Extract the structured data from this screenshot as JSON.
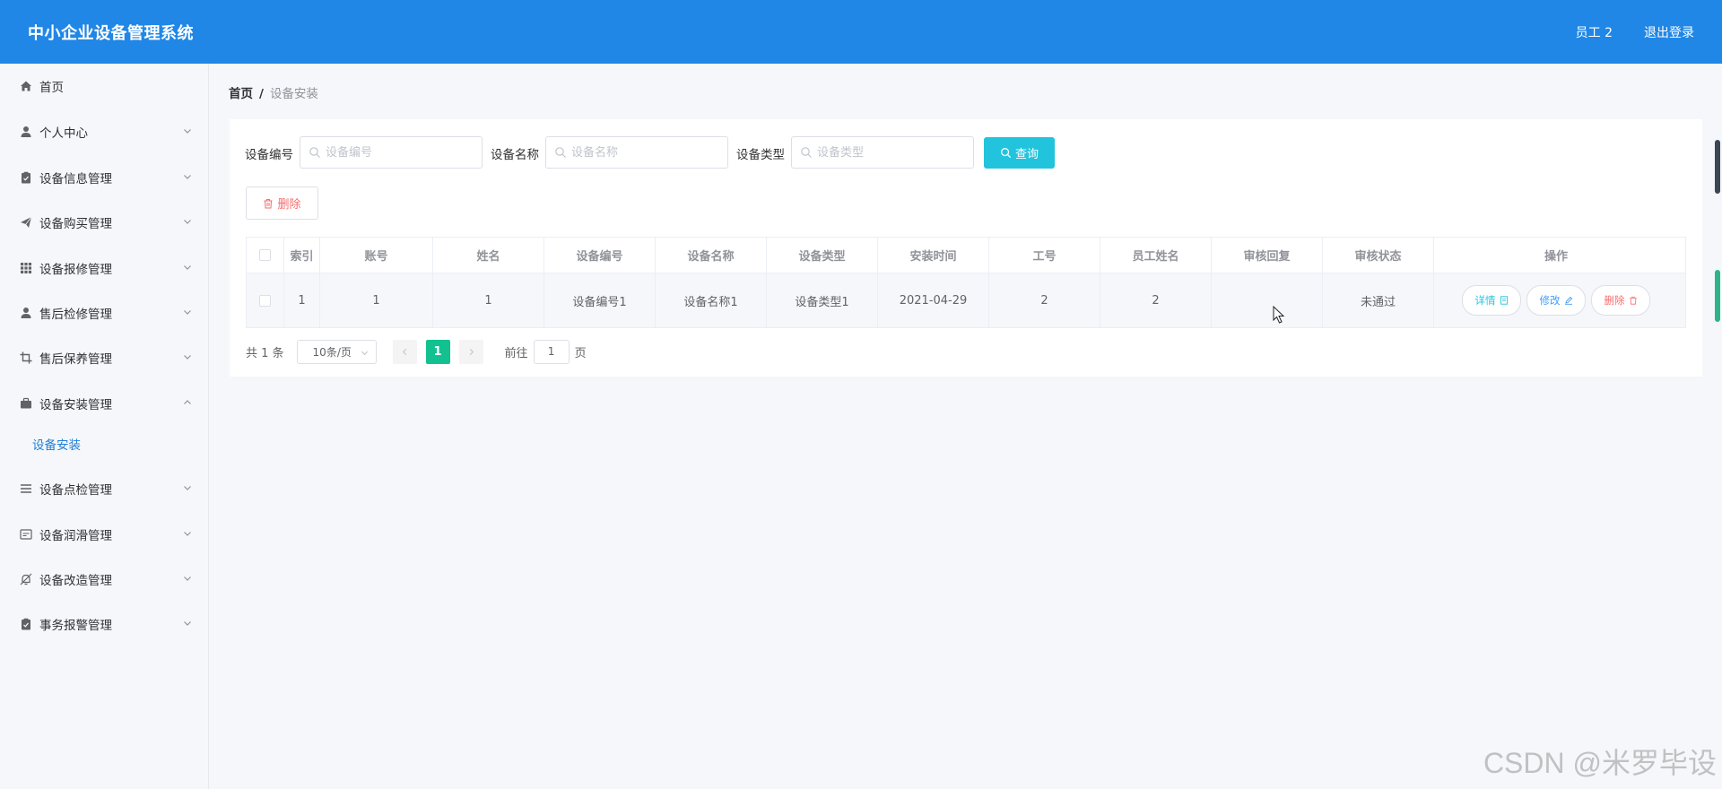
{
  "app": {
    "title": "中小企业设备管理系统",
    "user": "员工 2",
    "logout": "退出登录"
  },
  "sidebar": {
    "items": [
      {
        "label": "首页",
        "icon": "home-icon"
      },
      {
        "label": "个人中心",
        "icon": "user-icon"
      },
      {
        "label": "设备信息管理",
        "icon": "clipboard-icon"
      },
      {
        "label": "设备购买管理",
        "icon": "send-icon"
      },
      {
        "label": "设备报修管理",
        "icon": "grid-icon"
      },
      {
        "label": "售后检修管理",
        "icon": "user-icon"
      },
      {
        "label": "售后保养管理",
        "icon": "crop-icon"
      },
      {
        "label": "设备安装管理",
        "icon": "briefcase-icon"
      },
      {
        "label": "设备点检管理",
        "icon": "list-icon"
      },
      {
        "label": "设备润滑管理",
        "icon": "message-icon"
      },
      {
        "label": "设备改造管理",
        "icon": "bell-off-icon"
      },
      {
        "label": "事务报警管理",
        "icon": "clipboard-icon"
      }
    ],
    "subitem": {
      "label": "设备安装"
    }
  },
  "breadcrumb": {
    "home": "首页",
    "separator": "/",
    "current": "设备安装"
  },
  "search": {
    "fields": [
      {
        "label": "设备编号",
        "placeholder": "设备编号"
      },
      {
        "label": "设备名称",
        "placeholder": "设备名称"
      },
      {
        "label": "设备类型",
        "placeholder": "设备类型"
      }
    ],
    "query_label": "查询"
  },
  "toolbar": {
    "delete_label": "删除"
  },
  "table": {
    "headers": [
      "索引",
      "账号",
      "姓名",
      "设备编号",
      "设备名称",
      "设备类型",
      "安装时间",
      "工号",
      "员工姓名",
      "审核回复",
      "审核状态",
      "操作"
    ],
    "rows": [
      {
        "index": "1",
        "account": "1",
        "name": "1",
        "device_no": "设备编号1",
        "device_name": "设备名称1",
        "device_type": "设备类型1",
        "install_time": "2021-04-29",
        "job_no": "2",
        "employee_name": "2",
        "review_reply": "",
        "review_status": "未通过"
      }
    ],
    "actions": {
      "detail": "详情",
      "edit": "修改",
      "delete": "删除"
    }
  },
  "pagination": {
    "total": "共 1 条",
    "page_size": "10条/页",
    "current_page": "1",
    "goto_prefix": "前往",
    "goto_value": "1",
    "goto_suffix": "页"
  },
  "watermark": "CSDN @米罗毕设",
  "colors": {
    "header": "#2087e6",
    "accent": "#22c3dc",
    "active_page": "#13c190",
    "danger": "#f56c6c"
  }
}
